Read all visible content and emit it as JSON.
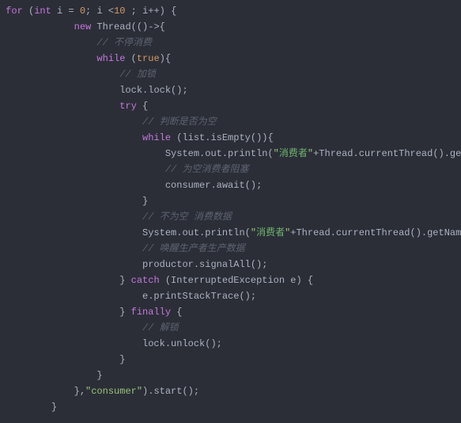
{
  "code": {
    "l1": {
      "kw1": "for",
      "type1": "int",
      "var": " i = ",
      "num0": "0",
      "mid": "; i <",
      "num10": "10",
      "rest": " ; i++) {"
    },
    "l2": {
      "kw": "new",
      "rest": " Thread(()->{"
    },
    "l3": {
      "comment": "// 不停消费"
    },
    "l4": {
      "kw": "while",
      "paren": " (",
      "true": "true",
      "rest": "){"
    },
    "l5": {
      "comment": "// 加锁"
    },
    "l6": {
      "text": "lock.lock();"
    },
    "l7": {
      "kw": "try",
      "rest": " {"
    },
    "l8": {
      "comment": "// 判断是否为空"
    },
    "l9": {
      "kw": "while",
      "rest": " (list.isEmpty()){"
    },
    "l10": {
      "pre": "System.out.println(",
      "q": "\"",
      "cn": "消费者",
      "q2": "\"",
      "post": "+Thread.currentThread().getName"
    },
    "l11": {
      "comment": "// 为空消费者阻塞"
    },
    "l12": {
      "text": "consumer.await();"
    },
    "l13": {
      "text": "}"
    },
    "l14": {
      "comment": "// 不为空 消费数据"
    },
    "l15": {
      "pre": "System.out.println(",
      "q": "\"",
      "cn": "消费者",
      "q2": "\"",
      "post": "+Thread.currentThread().getName()+\""
    },
    "l16": {
      "comment": "// 唤醒生产者生产数据"
    },
    "l17": {
      "text": "productor.signalAll();"
    },
    "l18": {
      "pre": "} ",
      "kw": "catch",
      "rest": " (InterruptedException e) {"
    },
    "l19": {
      "text": "e.printStackTrace();"
    },
    "l20": {
      "pre": "} ",
      "kw": "finally",
      "rest": " {"
    },
    "l21": {
      "comment": "// 解锁"
    },
    "l22": {
      "text": "lock.unlock();"
    },
    "l23": {
      "text": "}"
    },
    "l24": {
      "text": "}"
    },
    "l25": {
      "pre": "},",
      "q": "\"consumer\"",
      "post": ").start();"
    },
    "l26": {
      "text": "}"
    }
  }
}
